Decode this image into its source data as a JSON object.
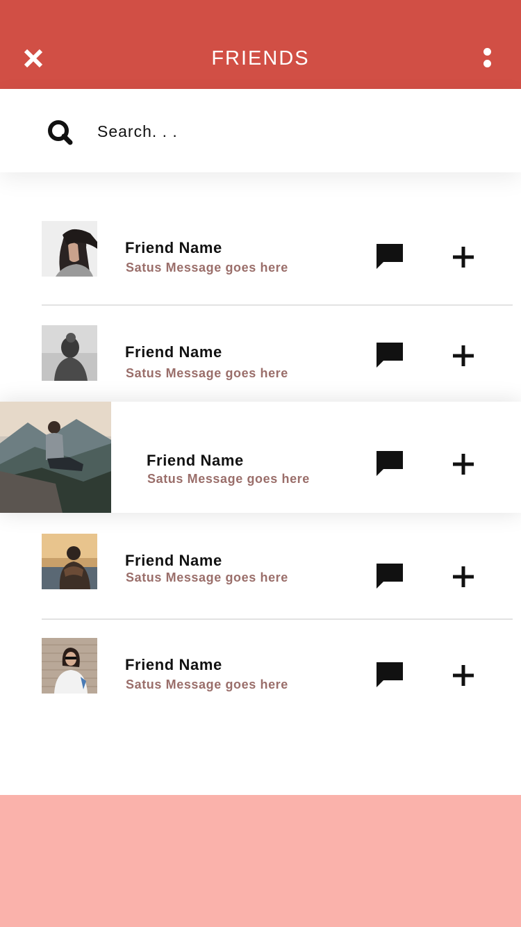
{
  "header": {
    "title": "FRIENDS",
    "close_icon": "close-icon",
    "more_icon": "more-vertical-icon",
    "background": "#d14f45"
  },
  "search": {
    "placeholder": "Search. . .",
    "icon": "search-icon"
  },
  "friends": [
    {
      "name": "Friend Name",
      "status": "Satus Message goes here",
      "avatar": "photo-woman-windblown-hair"
    },
    {
      "name": "Friend Name",
      "status": "Satus Message goes here",
      "avatar": "photo-person-backpack-grayscale"
    },
    {
      "name": "Friend Name",
      "status": "Satus Message goes here",
      "avatar": "photo-man-sitting-on-wall-mountains",
      "selected": true
    },
    {
      "name": "Friend Name",
      "status": "Satus Message goes here",
      "avatar": "photo-person-scarf-sunset"
    },
    {
      "name": "Friend Name",
      "status": "Satus Message goes here",
      "avatar": "photo-woman-sunglasses-brick-wall"
    }
  ],
  "row_actions": {
    "chat_icon": "chat-bubble-icon",
    "add_icon": "plus-icon"
  },
  "colors": {
    "accent": "#d14f45",
    "status_text": "#9a6e6a",
    "footer": "#fab2ab"
  }
}
